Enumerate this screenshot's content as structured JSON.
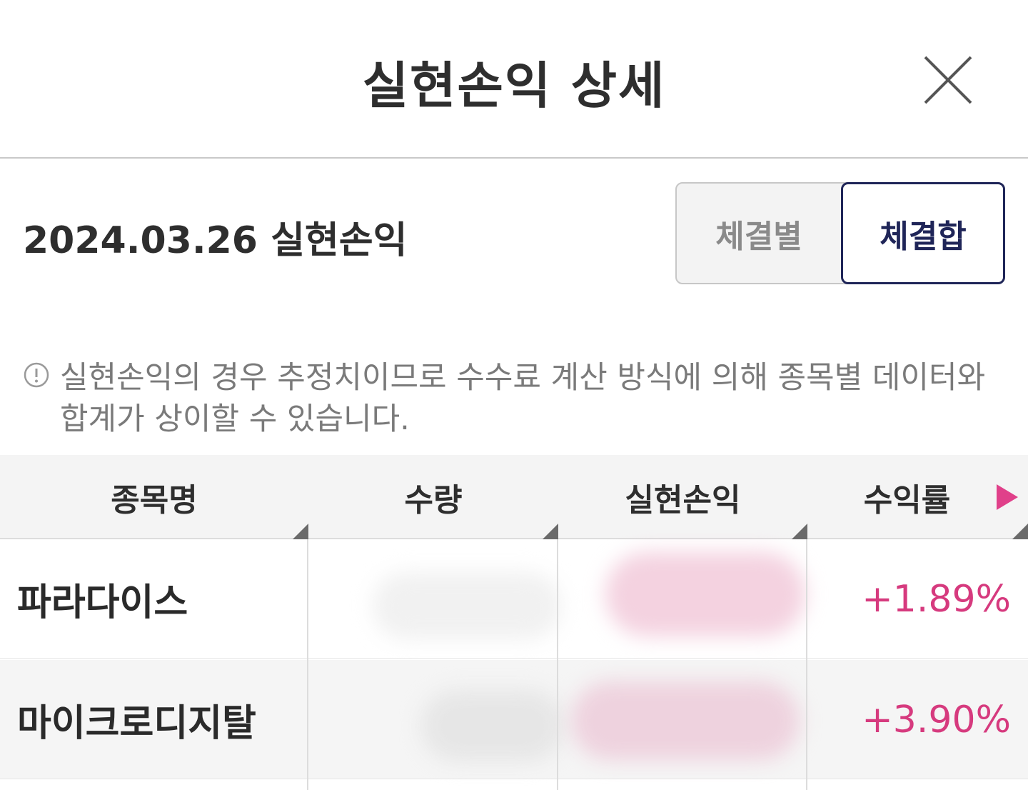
{
  "header": {
    "title": "실현손익 상세"
  },
  "summary": {
    "title": "2024.03.26 실현손익"
  },
  "segment": {
    "left_label": "체결별",
    "right_label": "체결합",
    "selected": "체결합"
  },
  "notice": {
    "text": "실현손익의 경우 추정치이므로 수수료 계산 방식에 의해 종목별 데이터와 합계가 상이할 수 있습니다."
  },
  "table": {
    "columns": [
      "종목명",
      "수량",
      "실현손익",
      "수익률"
    ],
    "rows": [
      {
        "name": "파라다이스",
        "rate": "+1.89%"
      },
      {
        "name": "마이크로디지탈",
        "rate": "+3.90%"
      }
    ]
  },
  "colors": {
    "accent_navy": "#1f2558",
    "profit_pink": "#d63a7e",
    "arrow_pink": "#e0408a"
  },
  "icons": {
    "close": "close-icon",
    "notice": "info-circle-icon",
    "next": "triangle-right-icon"
  }
}
